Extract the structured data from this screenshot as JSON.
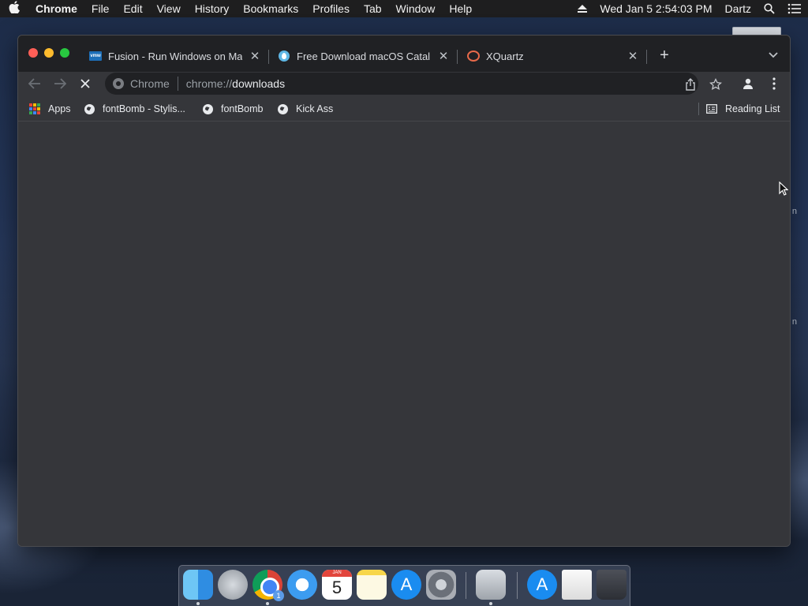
{
  "menubar": {
    "app_name": "Chrome",
    "items": [
      "File",
      "Edit",
      "View",
      "History",
      "Bookmarks",
      "Profiles",
      "Tab",
      "Window",
      "Help"
    ],
    "datetime": "Wed Jan 5  2:54:03 PM",
    "user": "Dartz"
  },
  "tabs": [
    {
      "title": "Fusion - Run Windows on Mac",
      "favicon": "vmware-icon"
    },
    {
      "title": "Free Download macOS Catalina",
      "favicon": "drop-icon"
    },
    {
      "title": "XQuartz",
      "favicon": "xquartz-icon"
    }
  ],
  "toolbar": {
    "chip_label": "Chrome",
    "url_scheme": "chrome://",
    "url_host": "downloads"
  },
  "bookmarks": {
    "items": [
      "Apps",
      "fontBomb - Stylis...",
      "fontBomb",
      "Kick Ass"
    ],
    "reading_list": "Reading List"
  },
  "dock": {
    "calendar_month": "JAN",
    "calendar_day": "5",
    "chrome_badge": "1"
  },
  "colors": {
    "window_bg": "#35363a",
    "tabstrip_bg": "#202124",
    "traffic_close": "#ff5f57",
    "traffic_min": "#febc2e",
    "traffic_max": "#28c840"
  }
}
